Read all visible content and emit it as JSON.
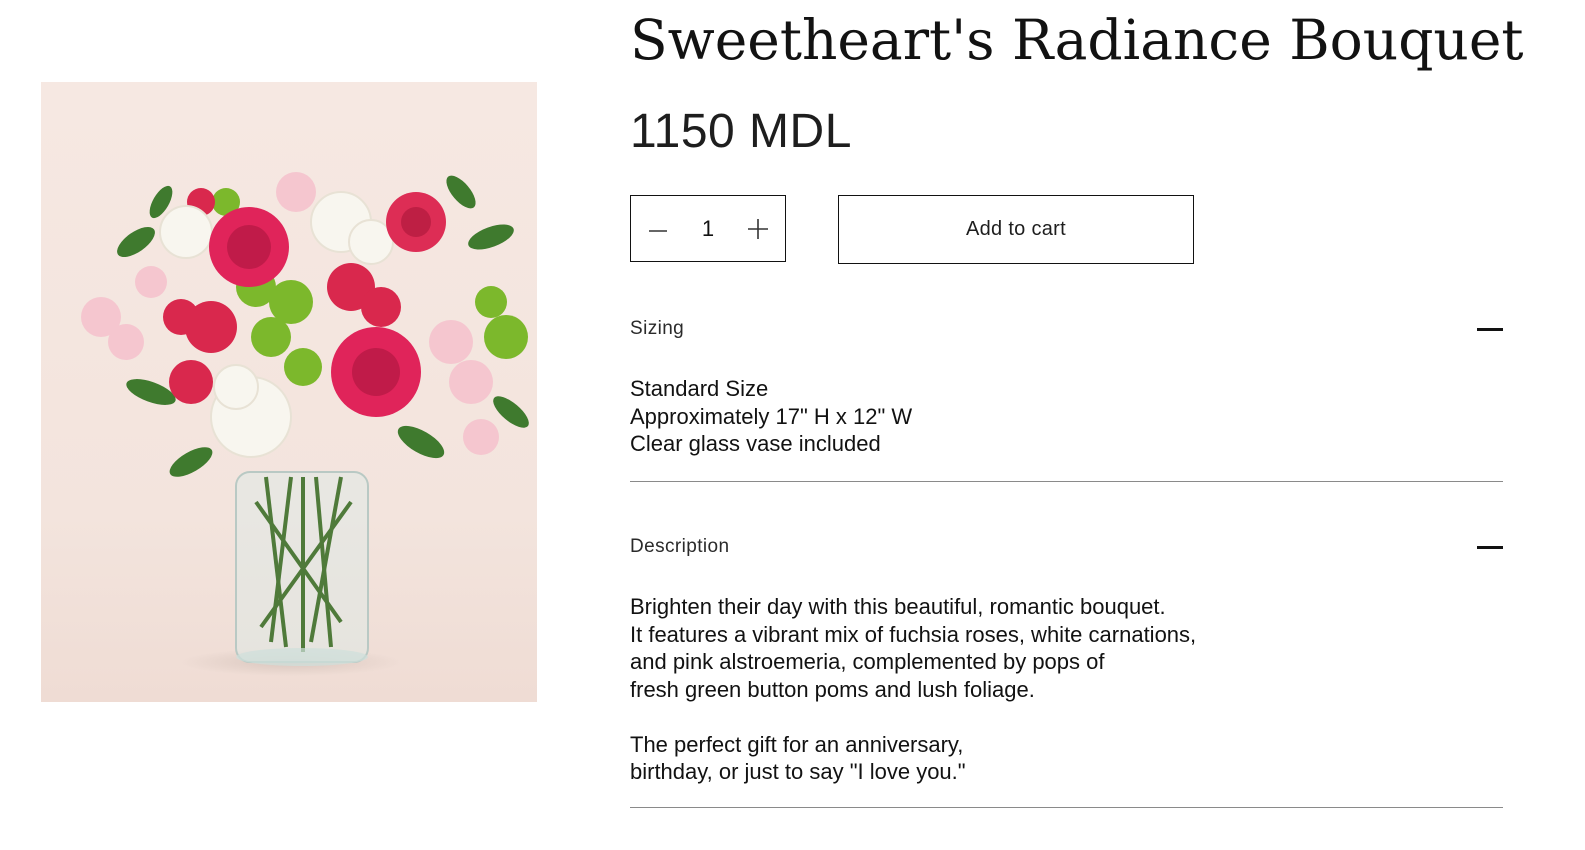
{
  "product": {
    "image_alt": "Bouquet of fuchsia roses, white carnations, pink alstroemeria and green button poms in a clear glass vase",
    "title": "Sweetheart's Radiance Bouquet",
    "price": "1150 MDL"
  },
  "quantity": {
    "decrease_icon": "minus-icon",
    "value": "1",
    "increase_icon": "plus-icon"
  },
  "add_to_cart_label": "Add to cart",
  "accordions": {
    "sizing": {
      "title": "Sizing",
      "toggle_icon": "minus-icon",
      "lines": [
        "Standard Size",
        "Approximately 17\" H x 12\" W",
        "Clear glass vase included"
      ]
    },
    "description": {
      "title": "Description",
      "toggle_icon": "minus-icon",
      "lines": [
        "Brighten their day with this beautiful, romantic bouquet.",
        "It features a vibrant mix of fuchsia roses, white carnations,",
        "and pink alstroemeria, complemented by pops of",
        "fresh green button poms and lush foliage.",
        "",
        "The perfect gift for an anniversary,",
        "birthday, or just to say \"I love you.\""
      ]
    }
  }
}
